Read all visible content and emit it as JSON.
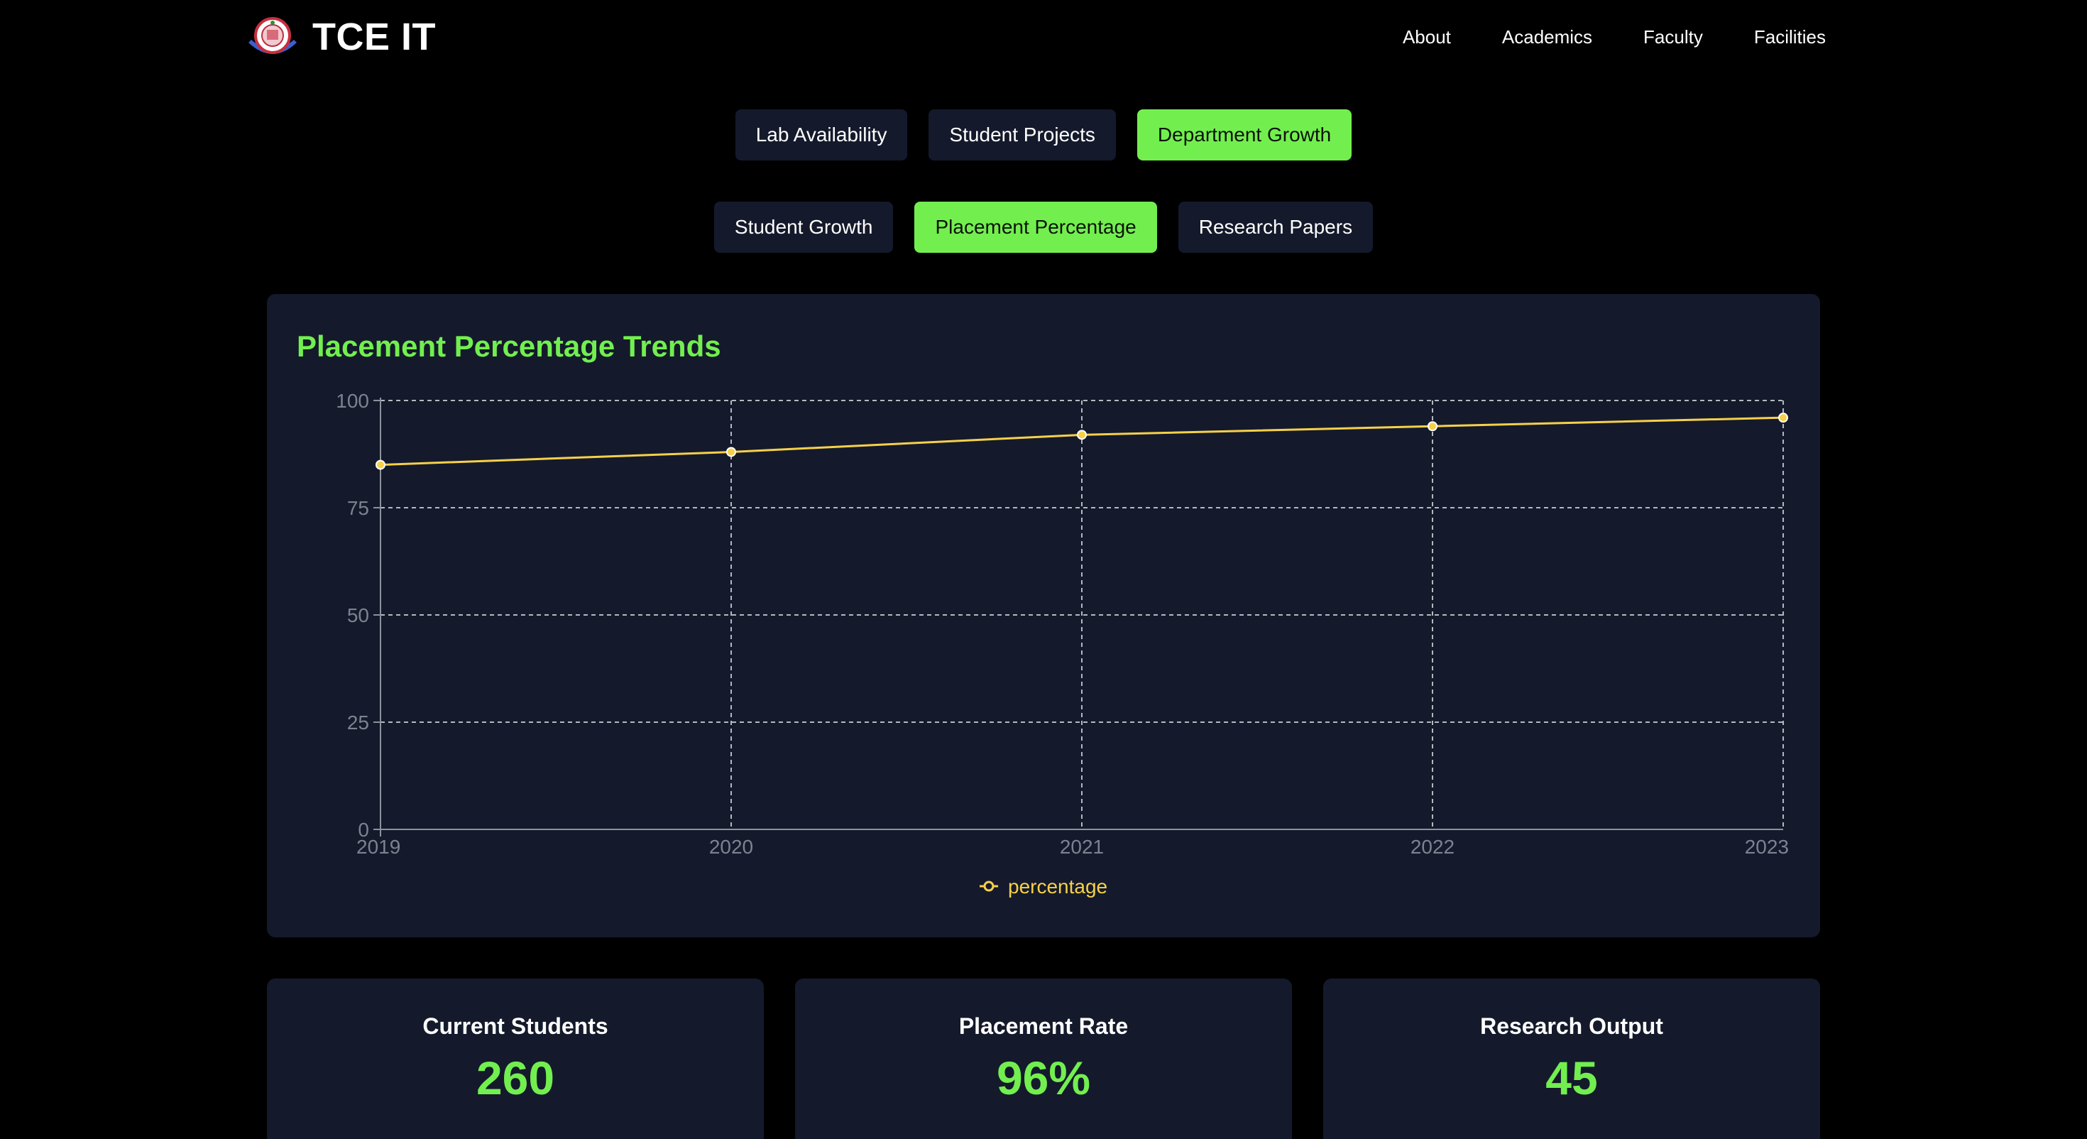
{
  "header": {
    "brand": "TCE IT",
    "nav": [
      "About",
      "Academics",
      "Faculty",
      "Facilities"
    ]
  },
  "tabs_primary": [
    {
      "label": "Lab Availability",
      "active": false
    },
    {
      "label": "Student Projects",
      "active": false
    },
    {
      "label": "Department Growth",
      "active": true
    }
  ],
  "tabs_secondary": [
    {
      "label": "Student Growth",
      "active": false
    },
    {
      "label": "Placement Percentage",
      "active": true
    },
    {
      "label": "Research Papers",
      "active": false
    }
  ],
  "chart": {
    "title": "Placement Percentage Trends"
  },
  "chart_data": {
    "type": "line",
    "x": [
      "2019",
      "2020",
      "2021",
      "2022",
      "2023"
    ],
    "series": [
      {
        "name": "percentage",
        "values": [
          85,
          88,
          92,
          94,
          96
        ]
      }
    ],
    "ylim": [
      0,
      100
    ],
    "yticks": [
      0,
      25,
      50,
      75,
      100
    ],
    "grid": true,
    "legend": "bottom-center"
  },
  "stats": [
    {
      "label": "Current Students",
      "value": "260"
    },
    {
      "label": "Placement Rate",
      "value": "96%"
    },
    {
      "label": "Research Output",
      "value": "45"
    }
  ],
  "colors": {
    "accent": "#72ef4f",
    "line": "#f7d04a",
    "card": "#141a2b",
    "background": "#000000",
    "axis_text": "#7c8290",
    "grid": "#c7cad1"
  }
}
